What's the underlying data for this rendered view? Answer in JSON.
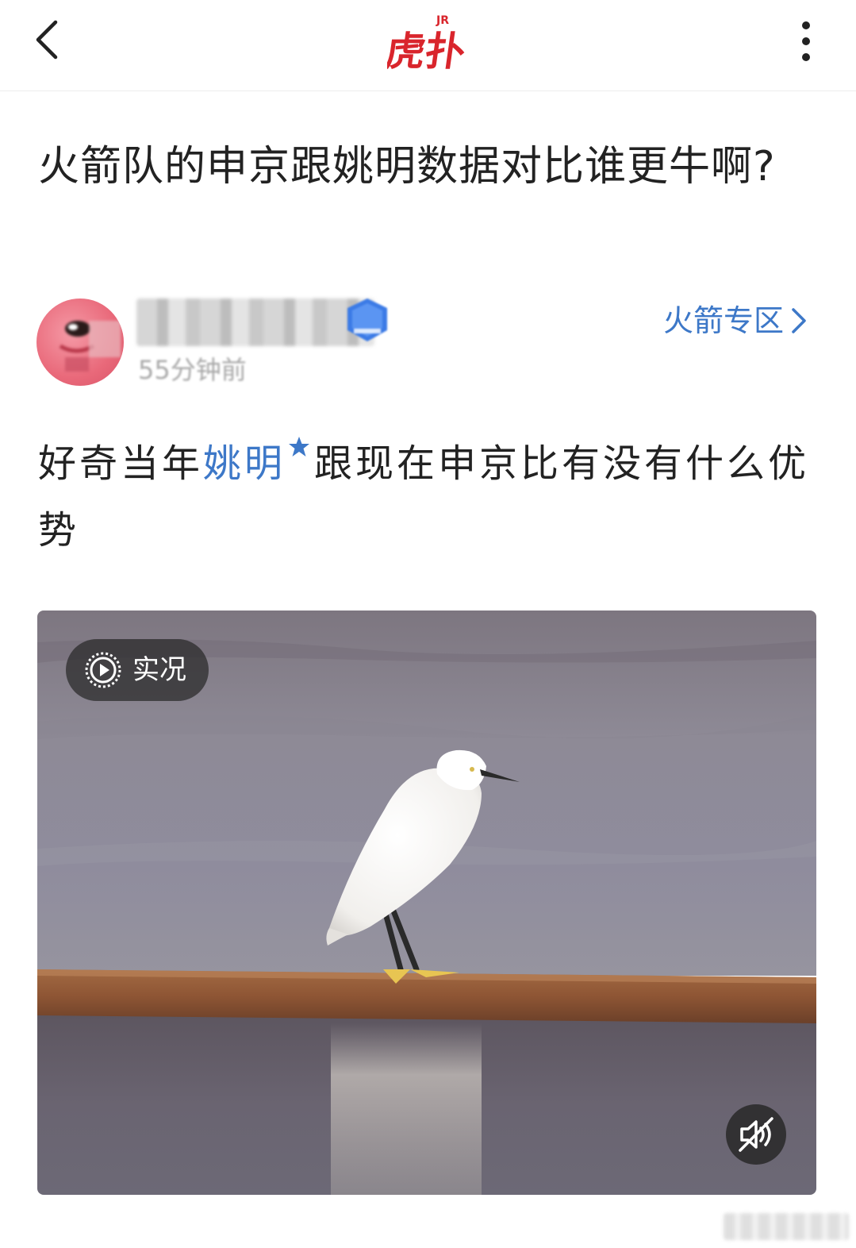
{
  "header": {
    "logo_text": "虎扑",
    "logo_sup": "JR"
  },
  "post": {
    "title": "火箭队的申京跟姚明数据对比谁更牛啊?",
    "author": {
      "name": "████████",
      "time": "55分钟前"
    },
    "forum_link": "火箭专区",
    "body_before": "好奇当年",
    "body_tag": "姚明",
    "body_after": "跟现在申京比有没有什么优势",
    "media": {
      "badge_label": "实况"
    }
  },
  "colors": {
    "brand_red": "#d9252c",
    "link_blue": "#3d78c8",
    "text": "#222222",
    "muted": "#a8a8a8"
  },
  "icons": {
    "back": "chevron-left-icon",
    "more": "vertical-dots-icon",
    "forum_arrow": "chevron-right-icon",
    "tag": "star-icon",
    "live": "play-circle-icon",
    "mute": "speaker-muted-icon"
  }
}
